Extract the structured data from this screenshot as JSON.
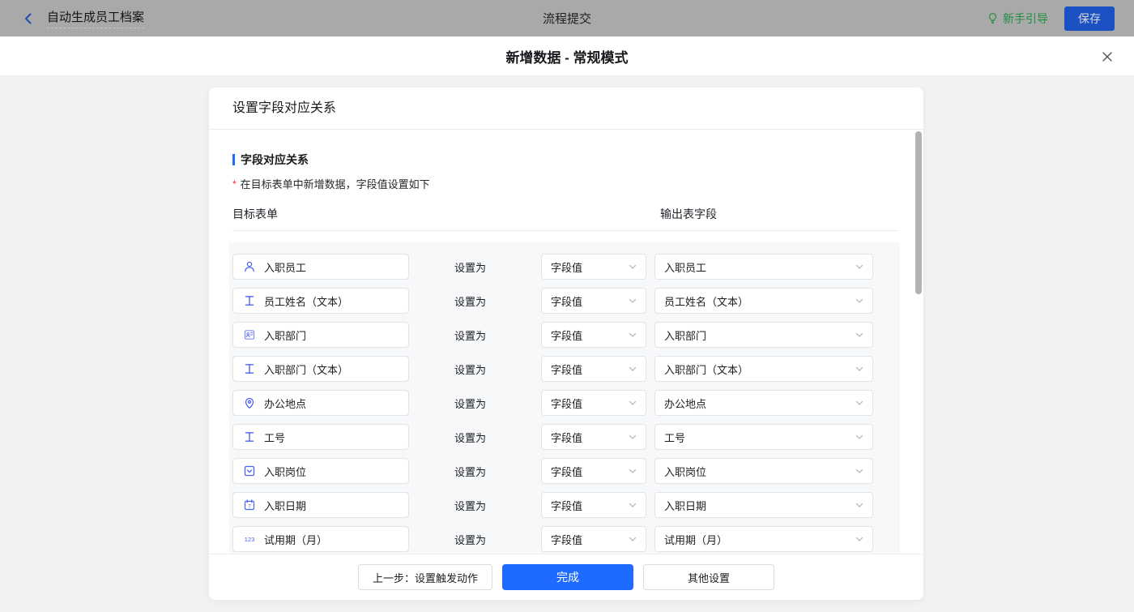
{
  "topbar": {
    "back_title": "自动生成员工档案",
    "center_title": "流程提交",
    "guide_label": "新手引导",
    "save_label": "保存"
  },
  "modal": {
    "title": "新增数据 - 常规模式",
    "panel_title": "设置字段对应关系",
    "section_title": "字段对应关系",
    "hint": "在目标表单中新增数据，字段值设置如下",
    "col_left": "目标表单",
    "col_right": "输出表字段",
    "set_as_label": "设置为",
    "rows": [
      {
        "icon": "member-icon",
        "field": "入职员工",
        "mode": "字段值",
        "output": "入职员工"
      },
      {
        "icon": "text-icon",
        "field": "员工姓名（文本）",
        "mode": "字段值",
        "output": "员工姓名（文本）"
      },
      {
        "icon": "department-icon",
        "field": "入职部门",
        "mode": "字段值",
        "output": "入职部门"
      },
      {
        "icon": "text-icon",
        "field": "入职部门（文本）",
        "mode": "字段值",
        "output": "入职部门（文本）"
      },
      {
        "icon": "location-icon",
        "field": "办公地点",
        "mode": "字段值",
        "output": "办公地点"
      },
      {
        "icon": "text-icon",
        "field": "工号",
        "mode": "字段值",
        "output": "工号"
      },
      {
        "icon": "select-icon",
        "field": "入职岗位",
        "mode": "字段值",
        "output": "入职岗位"
      },
      {
        "icon": "date-icon",
        "field": "入职日期",
        "mode": "字段值",
        "output": "入职日期"
      },
      {
        "icon": "number-icon",
        "field": "试用期（月）",
        "mode": "字段值",
        "output": "试用期（月）"
      },
      {
        "icon": "",
        "field": "",
        "mode": "",
        "output": ""
      }
    ],
    "footer": {
      "prev_label": "上一步：设置触发动作",
      "done_label": "完成",
      "other_label": "其他设置"
    }
  },
  "colors": {
    "primary_blue": "#1f6bff",
    "guide_green": "#1e8f41",
    "icon_blue": "#4a63f0",
    "required_red": "#f5222d"
  }
}
